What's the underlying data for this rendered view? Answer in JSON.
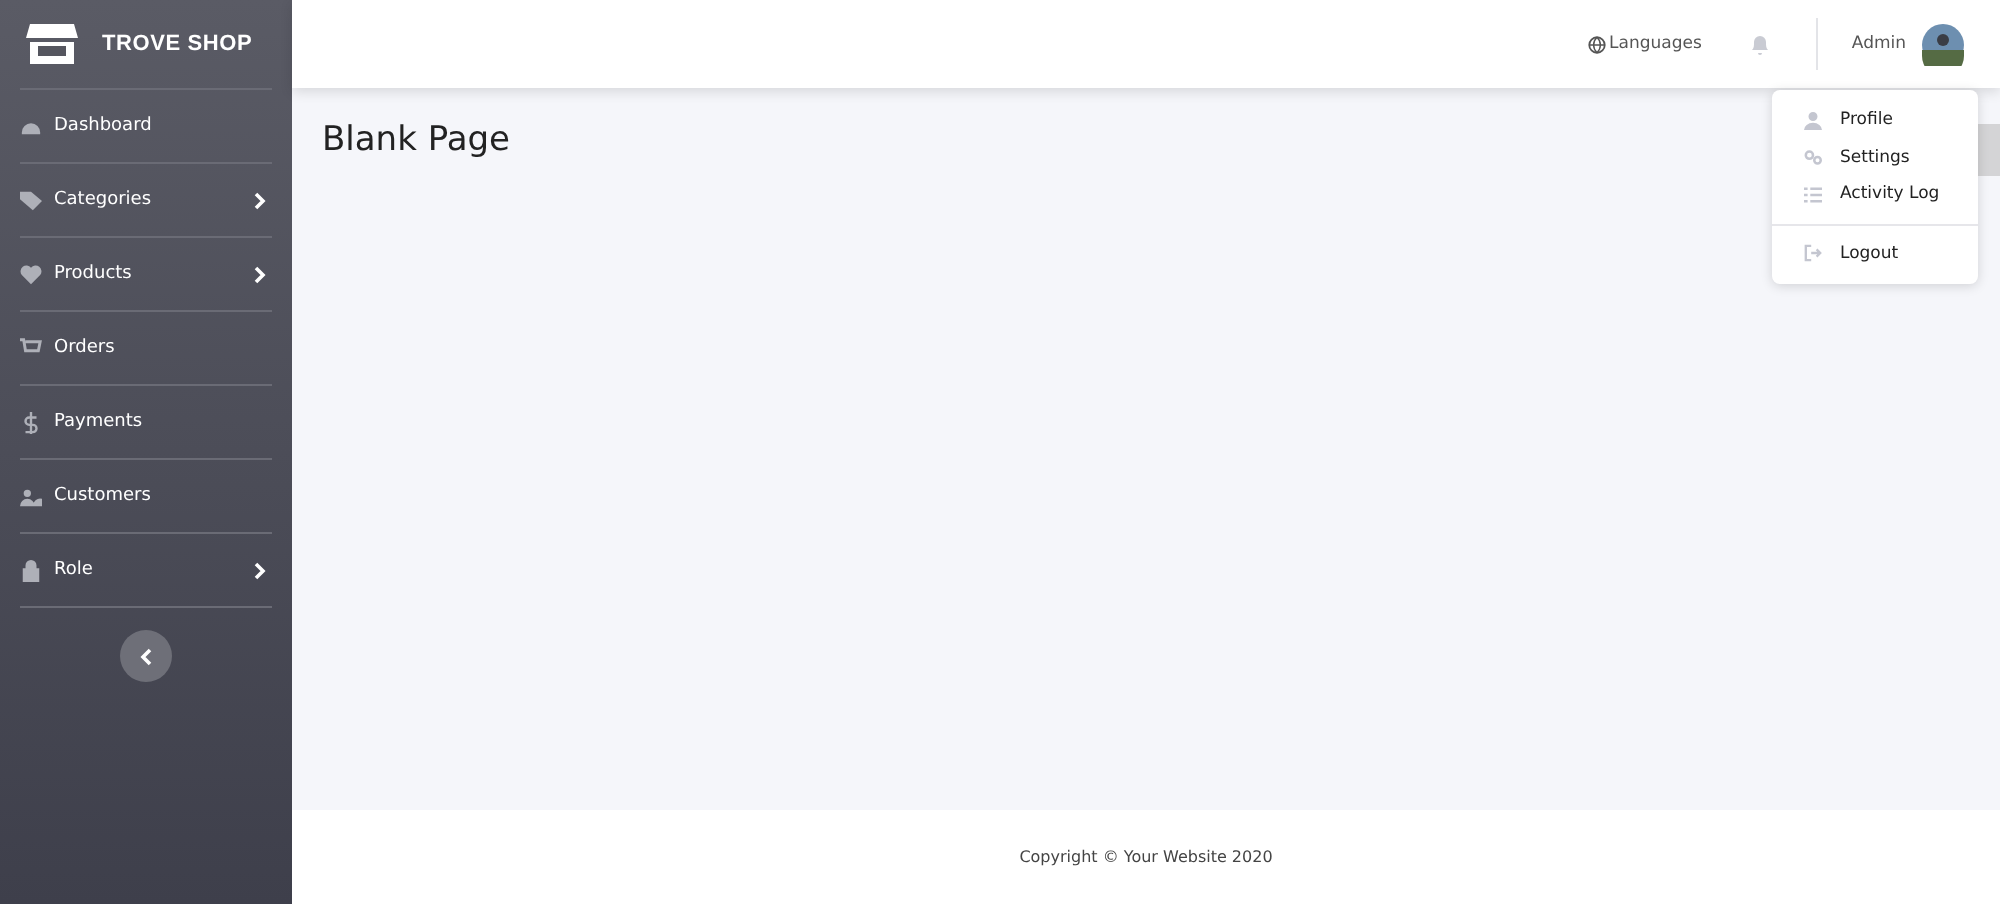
{
  "brand": {
    "name": "TROVE SHOP"
  },
  "sidebar": {
    "items": [
      {
        "label": "Dashboard",
        "kind": "dashboard",
        "has_submenu": false
      },
      {
        "label": "Categories",
        "kind": "tag",
        "has_submenu": true
      },
      {
        "label": "Products",
        "kind": "heart",
        "has_submenu": true
      },
      {
        "label": "Orders",
        "kind": "cart",
        "has_submenu": false
      },
      {
        "label": "Payments",
        "kind": "dollar",
        "has_submenu": false
      },
      {
        "label": "Customers",
        "kind": "users",
        "has_submenu": false
      },
      {
        "label": "Role",
        "kind": "lock",
        "has_submenu": true
      }
    ]
  },
  "header": {
    "languages": "Languages",
    "user": "Admin"
  },
  "page": {
    "title": "Blank Page"
  },
  "user_menu": {
    "items": [
      {
        "label": "Profile",
        "kind": "user",
        "divider_before": false
      },
      {
        "label": "Settings",
        "kind": "gears",
        "divider_before": false
      },
      {
        "label": "Activity Log",
        "kind": "list",
        "divider_before": false
      },
      {
        "label": "Logout",
        "kind": "logout",
        "divider_before": true
      }
    ]
  },
  "footer": {
    "text": "Copyright © Your Website 2020"
  }
}
